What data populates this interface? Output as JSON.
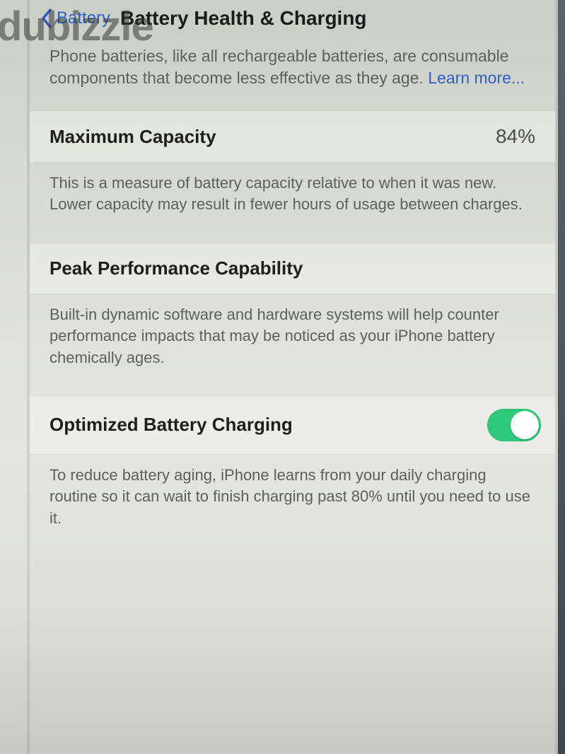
{
  "watermark": "dubizzle",
  "nav": {
    "back_label": "Battery",
    "title": "Battery Health & Charging"
  },
  "intro": {
    "text": "Phone batteries, like all rechargeable batteries, are consumable components that become less effective as they age. ",
    "learn_more": "Learn more..."
  },
  "capacity": {
    "label": "Maximum Capacity",
    "value": "84%",
    "note": "This is a measure of battery capacity relative to when it was new. Lower capacity may result in fewer hours of usage between charges."
  },
  "peak": {
    "label": "Peak Performance Capability",
    "note": "Built-in dynamic software and hardware systems will help counter performance impacts that may be noticed as your iPhone battery chemically ages."
  },
  "optimized": {
    "label": "Optimized Battery Charging",
    "enabled": true,
    "note": "To reduce battery aging, iPhone learns from your daily charging routine so it can wait to finish charging past 80% until you need to use it."
  }
}
